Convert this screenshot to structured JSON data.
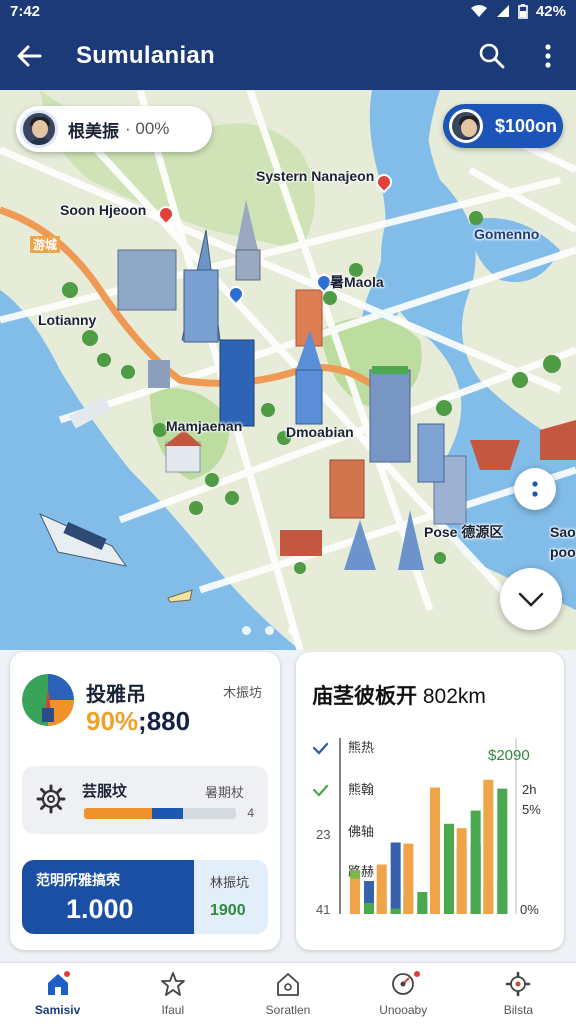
{
  "status_bar": {
    "time": "7:42",
    "battery": "42%"
  },
  "app_bar": {
    "title": "Sumulanian",
    "back_icon": "arrow-left-icon",
    "actions": [
      "search-icon",
      "more-vert-icon"
    ]
  },
  "map": {
    "user_chip": {
      "name": "根美振",
      "percent": "00%"
    },
    "credits_chip": {
      "value": "$100on"
    },
    "labels": {
      "system_navigation": "Systern Nanajeon",
      "soon_harbor": "Soon Hjeoon",
      "zone_tag": "游城",
      "lotus_bay": "Lotianny",
      "east_metro": "暑Maola",
      "gomenno": "Gomenno",
      "manhattan": "Mamjaenan",
      "downtown": "Dmoabian",
      "pose_zone": "Pose 德源区",
      "edge_top": "Sao",
      "edge_bottom": "poo"
    },
    "page_indicator": {
      "count": 3,
      "active": 0
    }
  },
  "score_card": {
    "title": "投雅吊",
    "side_label": "木振坊",
    "value_highlight": "90%",
    "value_rest": ";880"
  },
  "task_card": {
    "name": "芸服坟",
    "side_label": "暑期杖",
    "number": "4",
    "progress_orange": 0.45,
    "progress_blue": 0.2
  },
  "budget_card": {
    "label": "范明所雅搞荣",
    "value": "1.000",
    "side_label": "林振坑",
    "side_value": "1900"
  },
  "chart_card": {
    "title": "庙茎彼板开",
    "title_unit": "802km"
  },
  "chart_data": {
    "type": "bar",
    "title": "庙茎彼板开 802km",
    "legend": [
      {
        "label": "熊热",
        "marker": "check-blue"
      },
      {
        "label": "熊翰",
        "marker": "check-green"
      },
      {
        "label": "佛轴",
        "marker": "none"
      },
      {
        "label": "路赫",
        "marker": "none"
      }
    ],
    "left_ticks": [
      "23",
      "41"
    ],
    "right_labels": [
      "$2090",
      "2h",
      "5%",
      "0%"
    ],
    "series": [
      {
        "values": [
          4,
          1.5,
          1.8,
          6,
          6,
          2.5
        ]
      },
      {
        "values": [
          3,
          6.5,
          1.2,
          6.7,
          6.4,
          3
        ]
      },
      {
        "values": [
          3.2,
          4.5,
          6.4,
          11.5,
          7.8,
          12.2
        ]
      },
      {
        "values": [
          1,
          0.5,
          2,
          8.2,
          9.4,
          11.4
        ]
      }
    ],
    "colors": [
      "#7db84a",
      "#2c59a8",
      "#f0a44a",
      "#4aa84f"
    ]
  },
  "bottom_nav": [
    {
      "label": "Samisiv",
      "icon": "home-icon",
      "active": true,
      "badge": true
    },
    {
      "label": "Ifaul",
      "icon": "star-icon",
      "active": false,
      "badge": false
    },
    {
      "label": "Soratlen",
      "icon": "house-alert-icon",
      "active": false,
      "badge": false
    },
    {
      "label": "Unooaby",
      "icon": "target-icon",
      "active": false,
      "badge": true
    },
    {
      "label": "Bilsta",
      "icon": "settings-icon",
      "active": false,
      "badge": false
    }
  ]
}
